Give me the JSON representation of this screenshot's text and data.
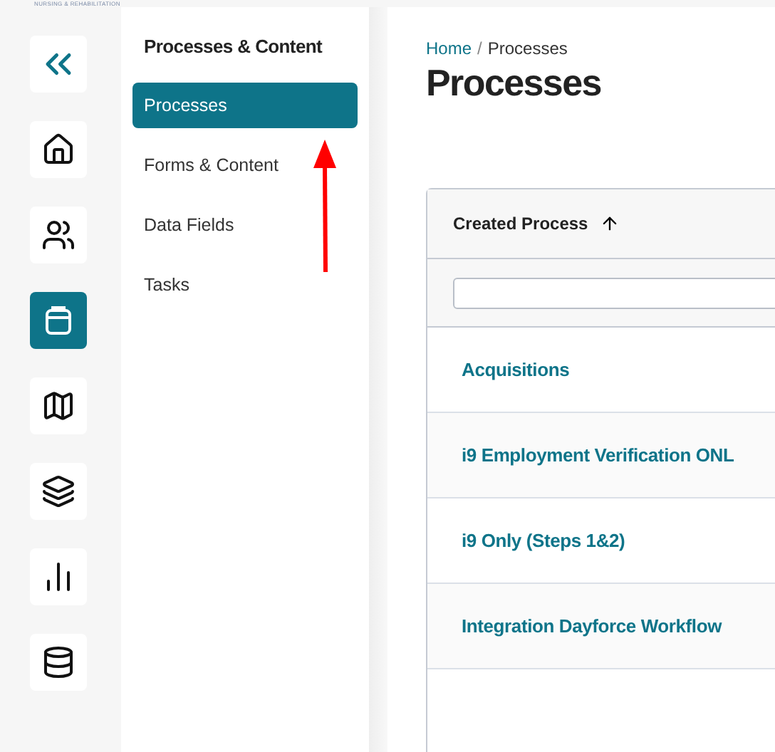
{
  "logo": {
    "tagline": "NURSING & REHABILITATION"
  },
  "rail": [
    {
      "kind": "collapse",
      "selected": false
    },
    {
      "kind": "home",
      "selected": false
    },
    {
      "kind": "users",
      "selected": false
    },
    {
      "kind": "clipboard",
      "selected": true
    },
    {
      "kind": "map",
      "selected": false
    },
    {
      "kind": "layers",
      "selected": false
    },
    {
      "kind": "chart",
      "selected": false
    },
    {
      "kind": "database",
      "selected": false
    }
  ],
  "sidebar": {
    "title": "Processes & Content",
    "items": [
      {
        "label": "Processes",
        "selected": true
      },
      {
        "label": "Forms & Content",
        "selected": false
      },
      {
        "label": "Data Fields",
        "selected": false
      },
      {
        "label": "Tasks",
        "selected": false
      }
    ]
  },
  "annotation": {
    "kind": "arrow"
  },
  "breadcrumb_separator": "/",
  "breadcrumb": [
    {
      "label": "Home",
      "link": true
    },
    {
      "label": "Processes",
      "link": false
    }
  ],
  "page_title": "Processes",
  "table": {
    "column": {
      "label": "Created Process",
      "sorted": true
    },
    "rows": [
      "Acquisitions",
      "i9 Employment Verification ONL",
      "i9 Only (Steps 1&2)",
      "Integration Dayforce Workflow"
    ]
  }
}
